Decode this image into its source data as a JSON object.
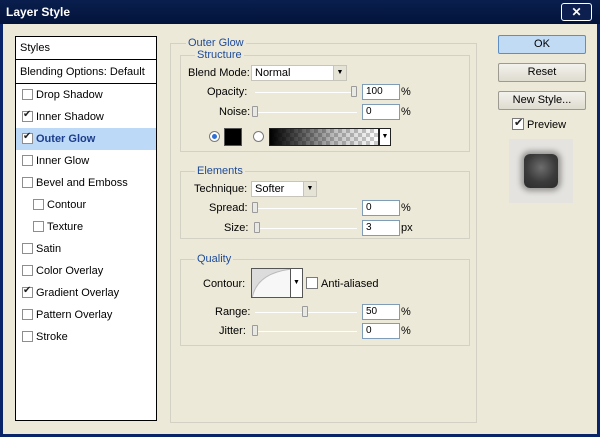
{
  "window": {
    "title": "Layer Style",
    "close_glyph": "✕"
  },
  "styles_list": {
    "header": "Styles",
    "blending": "Blending Options: Default",
    "items": [
      {
        "label": "Drop Shadow",
        "checked": false
      },
      {
        "label": "Inner Shadow",
        "checked": true
      },
      {
        "label": "Outer Glow",
        "checked": true,
        "selected": true
      },
      {
        "label": "Inner Glow",
        "checked": false
      },
      {
        "label": "Bevel and Emboss",
        "checked": false
      },
      {
        "label": "Contour",
        "checked": false
      },
      {
        "label": "Texture",
        "checked": false
      },
      {
        "label": "Satin",
        "checked": false
      },
      {
        "label": "Color Overlay",
        "checked": false
      },
      {
        "label": "Gradient Overlay",
        "checked": true
      },
      {
        "label": "Pattern Overlay",
        "checked": false
      },
      {
        "label": "Stroke",
        "checked": false
      }
    ]
  },
  "outer_glow": {
    "section_title": "Outer Glow",
    "structure": {
      "title": "Structure",
      "blend_mode_label": "Blend Mode:",
      "blend_mode_value": "Normal",
      "opacity_label": "Opacity:",
      "opacity_value": "100",
      "opacity_unit": "%",
      "noise_label": "Noise:",
      "noise_value": "0",
      "noise_unit": "%",
      "fill_mode": "solid",
      "glow_color": "#000000"
    },
    "elements": {
      "title": "Elements",
      "technique_label": "Technique:",
      "technique_value": "Softer",
      "spread_label": "Spread:",
      "spread_value": "0",
      "spread_unit": "%",
      "size_label": "Size:",
      "size_value": "3",
      "size_unit": "px"
    },
    "quality": {
      "title": "Quality",
      "contour_label": "Contour:",
      "anti_aliased_label": "Anti-aliased",
      "anti_aliased": false,
      "range_label": "Range:",
      "range_value": "50",
      "range_unit": "%",
      "jitter_label": "Jitter:",
      "jitter_value": "0",
      "jitter_unit": "%"
    }
  },
  "buttons": {
    "ok": "OK",
    "reset": "Reset",
    "new_style": "New Style..."
  },
  "preview": {
    "label": "Preview",
    "checked": true
  }
}
